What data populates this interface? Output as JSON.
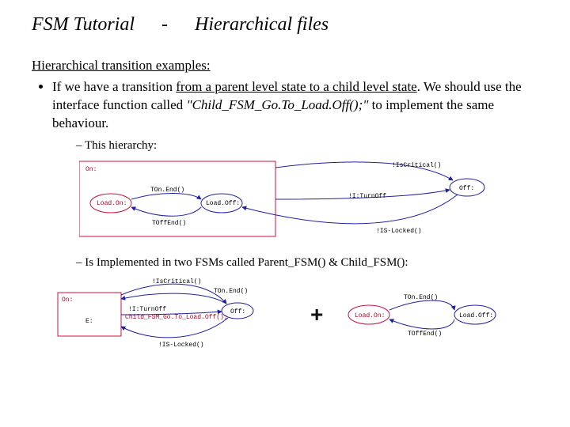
{
  "title": {
    "part1": "FSM Tutorial",
    "dash": "-",
    "part2": "Hierarchical files"
  },
  "intro": "Hierarchical transition examples:",
  "bullet": {
    "pre": "If  we have a transition ",
    "underlined": "from a parent level state to a child level state",
    "post1": ". We should use the interface function called ",
    "func": "\"Child_FSM_Go.To_Load.Off();\"",
    "post2": " to implement the same behaviour."
  },
  "sub": {
    "a": "This hierarchy:",
    "b": "Is Implemented in two FSMs called Parent_FSM() & Child_FSM():"
  },
  "diag1": {
    "onState": "On:",
    "offState": "Off:",
    "loadOn": "Load.On:",
    "loadOff": "Load.Off:",
    "tOnEnd": "TOn.End()",
    "tOffEnd": "TOffEnd()",
    "crit": "!IsCritical()",
    "iTurnOff": "!I:TurnOff",
    "isLocked": "!IS-Locked()"
  },
  "diag2a": {
    "on": "On:",
    "off": "Off:",
    "e": "E:",
    "critical": "!IsCritical()",
    "tonEnd": "TOn.End()",
    "iTurnOff": "!I:TurnOff\nChild_FSM_Go.To_Load.Off();",
    "isLocked": "!IS-Locked()"
  },
  "diag2b": {
    "loadOn": "Load.On:",
    "loadOff": "Load.Off:",
    "tonEnd": "TOn.End()",
    "tOffEnd": "TOffEnd()"
  }
}
